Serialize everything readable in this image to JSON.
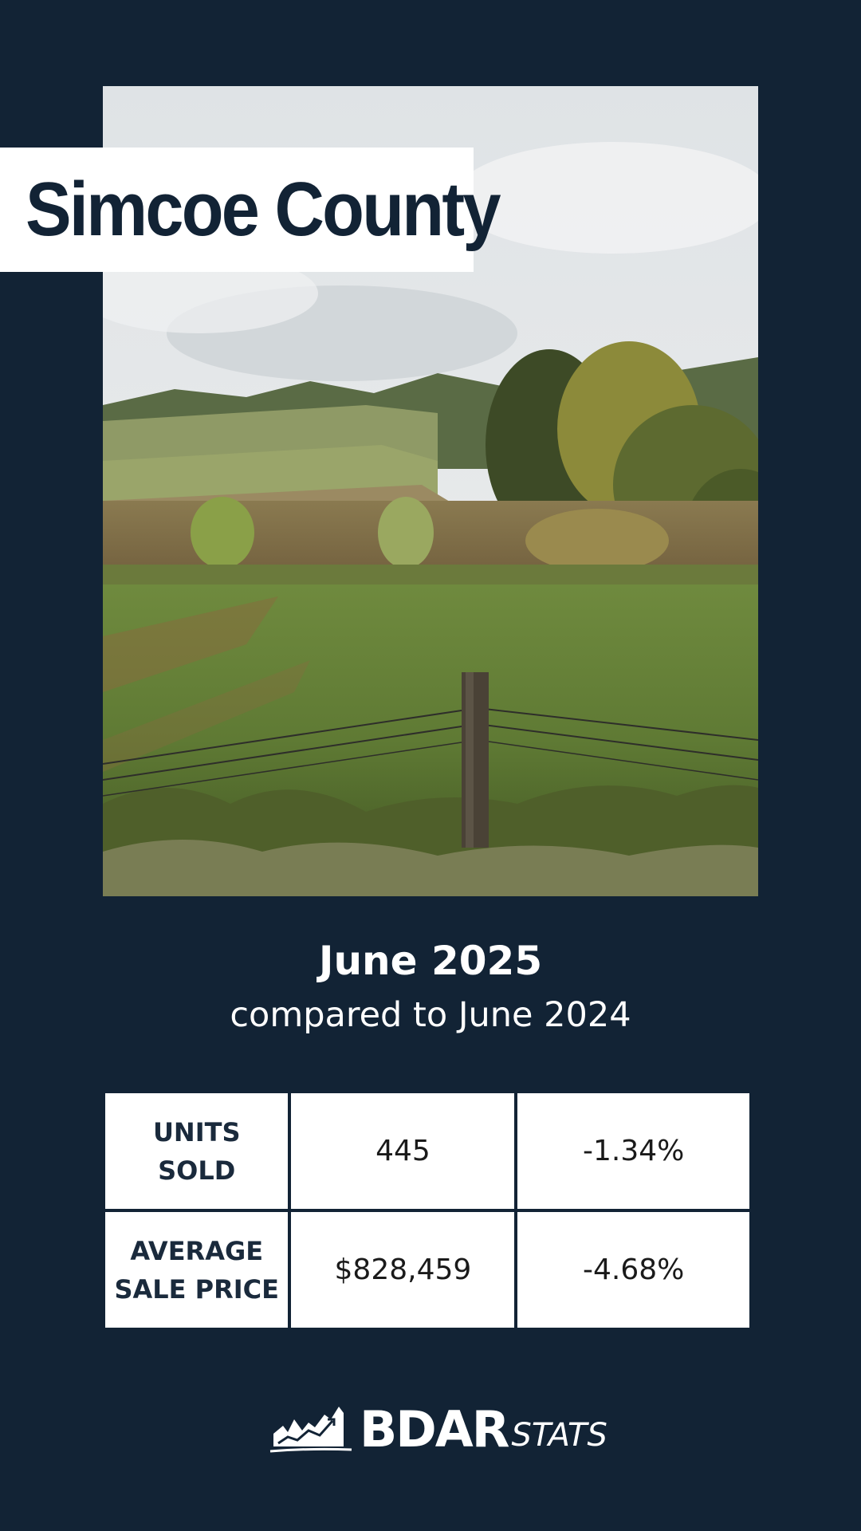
{
  "title": "Simcoe County",
  "period": "June 2025",
  "comparison": "compared to June 2024",
  "stats": [
    {
      "label_lines": [
        "UNITS",
        "SOLD"
      ],
      "value": "445",
      "change": "-1.34%"
    },
    {
      "label_lines": [
        "AVERAGE",
        "SALE PRICE"
      ],
      "value": "$828,459",
      "change": "-4.68%"
    }
  ],
  "logo": {
    "brand": "BDAR",
    "sub": "STATS",
    "icon": "rising-chart-icon"
  },
  "colors": {
    "background": "#122335",
    "panel": "#ffffff",
    "text_dark": "#122335"
  }
}
